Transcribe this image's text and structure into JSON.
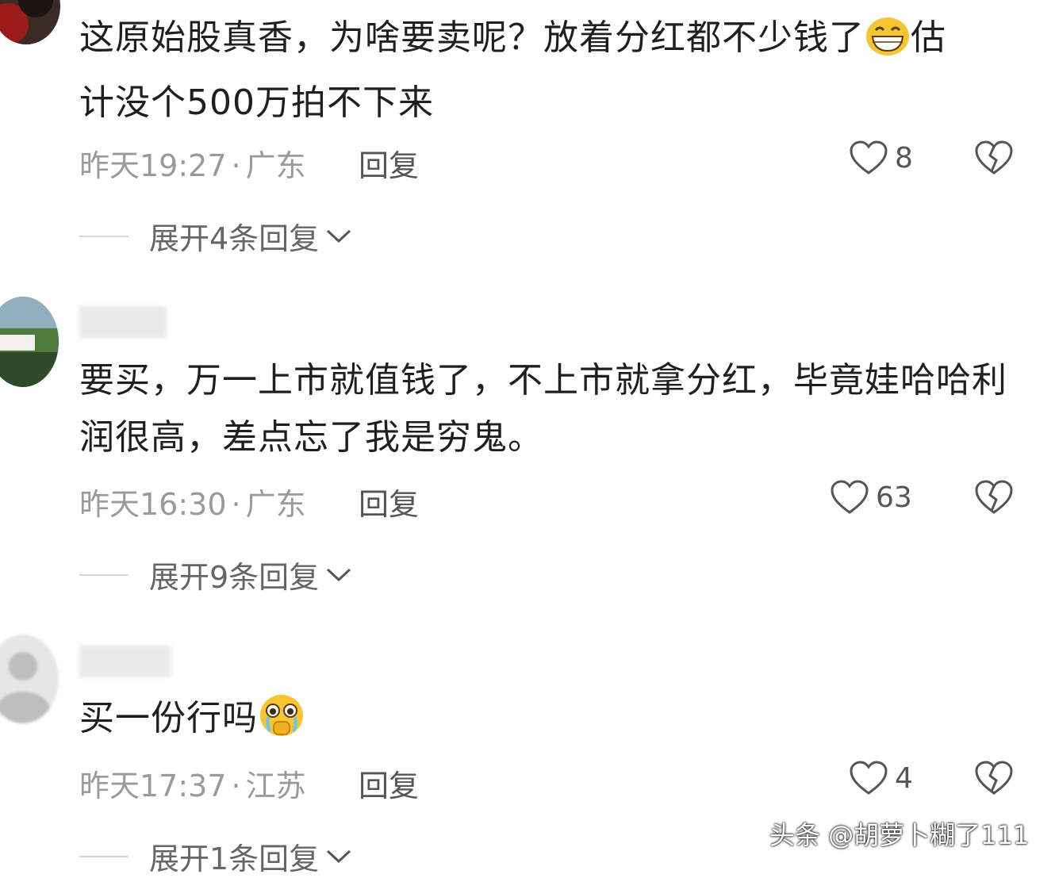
{
  "comments": [
    {
      "text_a": "这原始股真香，为啥要卖呢？放着分红都不少钱了",
      "emoji": "grin-emoji",
      "text_b": "估",
      "text_c": "计没个500万拍不下来",
      "time": "昨天19:27",
      "location": "广东",
      "reply_label": "回复",
      "likes": "8",
      "expand_label": "展开4条回复"
    },
    {
      "text": "要买，万一上市就值钱了，不上市就拿分红，毕竟娃哈哈利润很高，差点忘了我是穷鬼。",
      "time": "昨天16:30",
      "location": "广东",
      "reply_label": "回复",
      "likes": "63",
      "expand_label": "展开9条回复"
    },
    {
      "text": "买一份行吗",
      "emoji": "pleading-tears-emoji",
      "time": "昨天17:37",
      "location": "江苏",
      "reply_label": "回复",
      "likes": "4",
      "expand_label": "展开1条回复"
    }
  ],
  "separator": "·",
  "watermark": "头条 @胡萝卜糊了111",
  "colors": {
    "text": "#1f1f1f",
    "meta": "#9a9a9a",
    "icon": "#555555"
  }
}
